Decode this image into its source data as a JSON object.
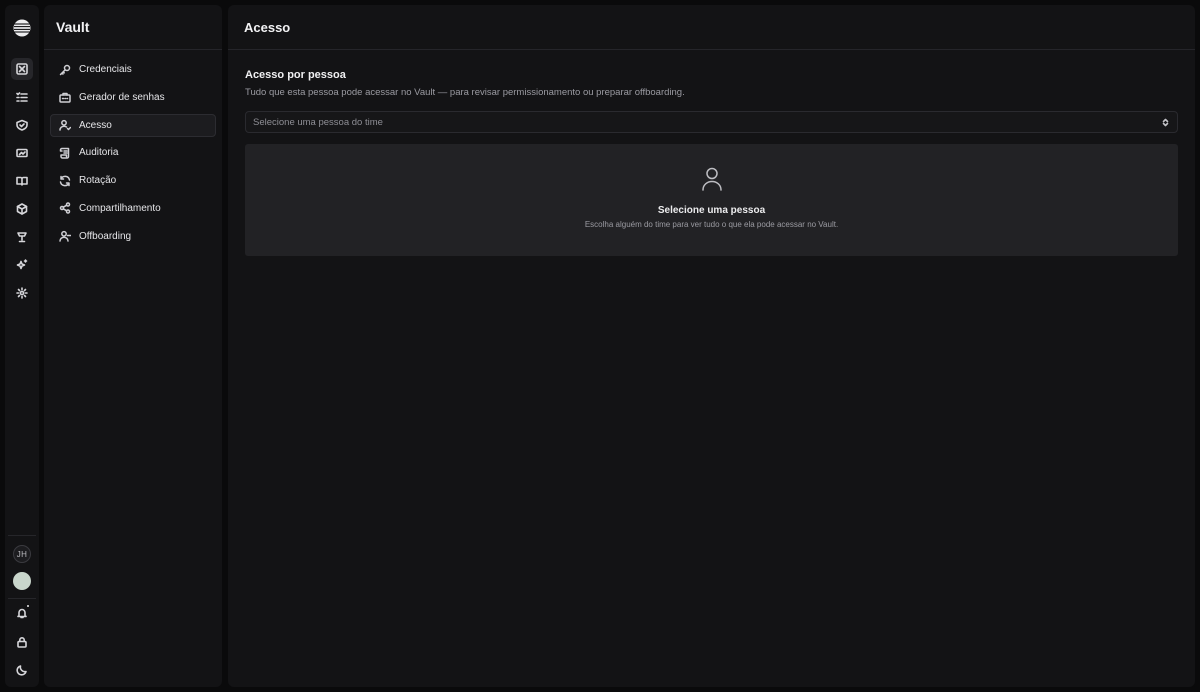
{
  "rail": {
    "items": [
      {
        "icon": "vault-icon",
        "active": true
      },
      {
        "icon": "checklist-icon"
      },
      {
        "icon": "shield-icon"
      },
      {
        "icon": "card-icon"
      },
      {
        "icon": "book-icon"
      },
      {
        "icon": "package-icon"
      },
      {
        "icon": "lamp-icon"
      },
      {
        "icon": "sparkles-icon"
      },
      {
        "icon": "gear-icon"
      }
    ],
    "user_initials": "JH"
  },
  "sidebar": {
    "title": "Vault",
    "items": [
      {
        "label": "Credenciais",
        "icon": "key-icon"
      },
      {
        "label": "Gerador de senhas",
        "icon": "generator-icon"
      },
      {
        "label": "Acesso",
        "icon": "user-access-icon",
        "active": true
      },
      {
        "label": "Auditoria",
        "icon": "audit-scroll-icon"
      },
      {
        "label": "Rotação",
        "icon": "refresh-icon"
      },
      {
        "label": "Compartilhamento",
        "icon": "share-icon"
      },
      {
        "label": "Offboarding",
        "icon": "user-minus-icon"
      }
    ]
  },
  "main": {
    "title": "Acesso",
    "section_title": "Acesso por pessoa",
    "section_desc": "Tudo que esta pessoa pode acessar no Vault — para revisar permissionamento ou preparar offboarding.",
    "select_placeholder": "Selecione uma pessoa do time",
    "empty_title": "Selecione uma pessoa",
    "empty_desc": "Escolha alguém do time para ver tudo o que ela pode acessar no Vault."
  },
  "colors": {
    "background": "#0a0a0b",
    "panel": "#131315",
    "empty_state": "#222225",
    "avatar": "#c9d6cc"
  }
}
